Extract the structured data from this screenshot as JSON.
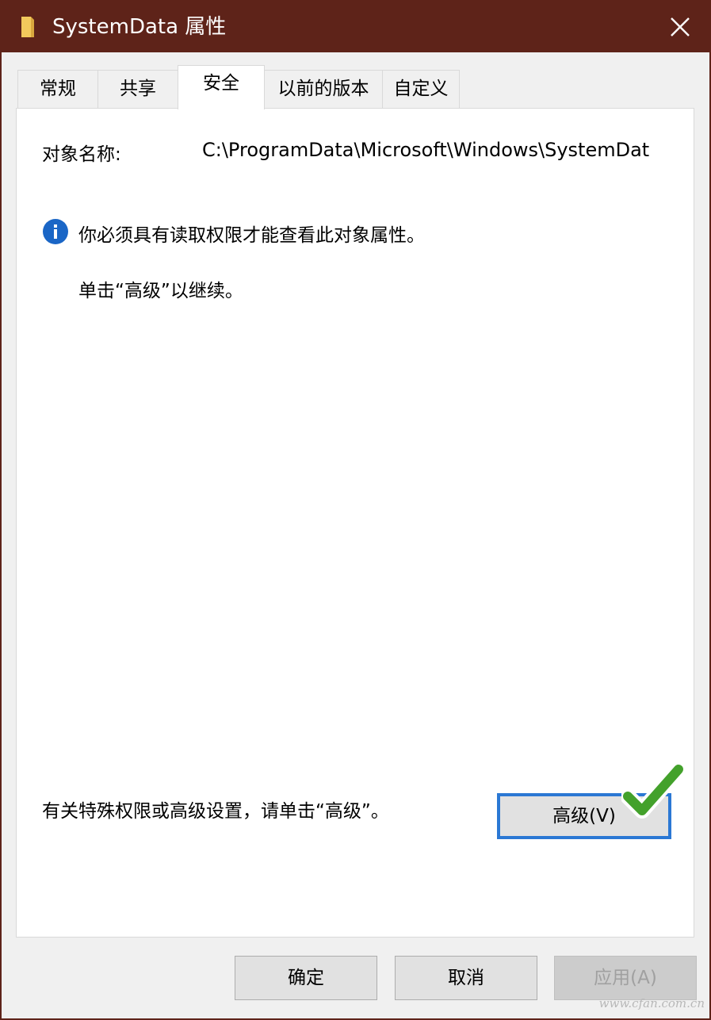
{
  "window": {
    "title": "SystemData 属性",
    "icon": "folder-icon",
    "close_icon": "close-icon"
  },
  "tabs": [
    {
      "label": "常规",
      "active": false
    },
    {
      "label": "共享",
      "active": false
    },
    {
      "label": "安全",
      "active": true
    },
    {
      "label": "以前的版本",
      "active": false
    },
    {
      "label": "自定义",
      "active": false
    }
  ],
  "security": {
    "object_name_label": "对象名称:",
    "object_path": "C:\\ProgramData\\Microsoft\\Windows\\SystemDat",
    "info_icon": "info-icon",
    "info_message": "你必须具有读取权限才能查看此对象属性。",
    "continue_message": "单击“高级”以继续。",
    "special_permissions_text": "有关特殊权限或高级设置，请单击“高级”。",
    "advanced_button": "高级(V)"
  },
  "footer": {
    "ok": "确定",
    "cancel": "取消",
    "apply": "应用(A)"
  },
  "watermark": "www.cfan.com.cn",
  "colors": {
    "titlebar": "#5e2319",
    "accent": "#2b78d4",
    "info_icon": "#1a66c6",
    "check_mark": "#43a12b"
  }
}
